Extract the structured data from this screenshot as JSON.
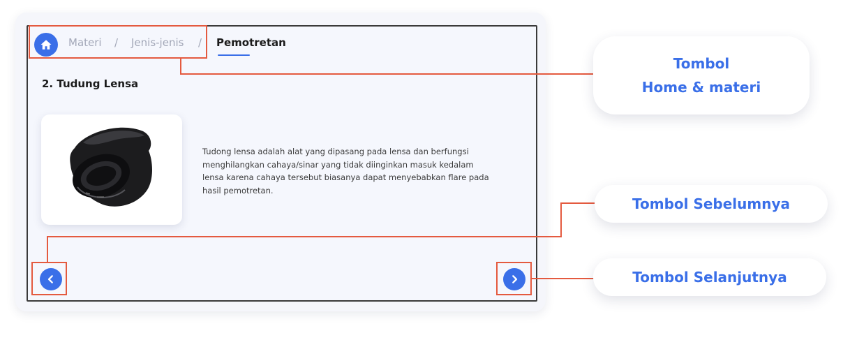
{
  "breadcrumb": {
    "items": [
      "Materi",
      "Jenis-jenis"
    ],
    "separator": "/",
    "active": "Pemotretan"
  },
  "content": {
    "section_title": "2. Tudung Lensa",
    "description": "Tudong lensa adalah alat yang dipasang pada lensa dan berfungsi menghilangkan cahaya/sinar yang tidak diinginkan masuk kedalam lensa karena cahaya tersebut biasanya dapat menyebabkan flare pada hasil pemotretan.",
    "image": "lens-hood-photo"
  },
  "callouts": {
    "home": [
      "Tombol",
      "Home & materi"
    ],
    "prev": "Tombol Sebelumnya",
    "next": "Tombol Selanjutnya"
  },
  "icons": {
    "home": "home-icon",
    "prev": "chevron-left-icon",
    "next": "chevron-right-icon"
  },
  "colors": {
    "accent": "#3a6fe8",
    "highlight": "#e45a3f",
    "text": "#1b1b1b",
    "muted": "#a3a8b8"
  }
}
